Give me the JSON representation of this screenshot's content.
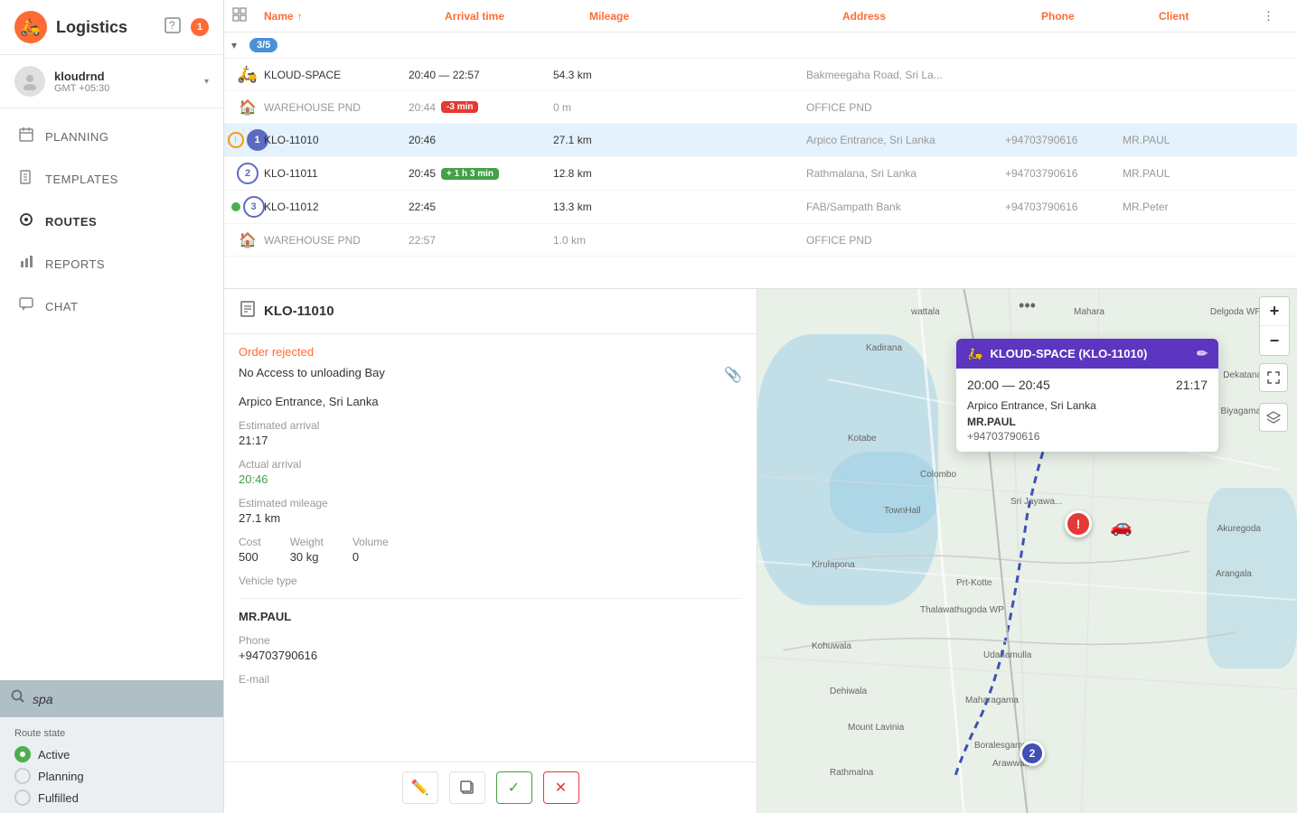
{
  "app": {
    "title": "Logistics",
    "badge": "1",
    "help_icon": "❓",
    "logo": "🛵"
  },
  "user": {
    "name": "kloudrnd",
    "timezone": "GMT +05:30"
  },
  "nav": {
    "items": [
      {
        "id": "planning",
        "label": "PLANNING",
        "icon": "📅"
      },
      {
        "id": "templates",
        "label": "TEMPLATES",
        "icon": "📄"
      },
      {
        "id": "routes",
        "label": "ROUTES",
        "icon": "👤",
        "active": true
      },
      {
        "id": "reports",
        "label": "REPORTS",
        "icon": "📊"
      },
      {
        "id": "chat",
        "label": "CHAT",
        "icon": "💬"
      }
    ]
  },
  "search": {
    "placeholder": "spa",
    "value": "spa"
  },
  "route_state": {
    "label": "Route state",
    "options": [
      {
        "id": "active",
        "label": "Active",
        "selected": true
      },
      {
        "id": "planning",
        "label": "Planning",
        "selected": false
      },
      {
        "id": "fulfilled",
        "label": "Fulfilled",
        "selected": false
      }
    ]
  },
  "table": {
    "columns": {
      "name": "Name",
      "arrival_time": "Arrival time",
      "mileage": "Mileage",
      "address": "Address",
      "phone": "Phone",
      "client": "Client"
    },
    "route": {
      "badge": "3/5",
      "stops": [
        {
          "id": "kloud-space",
          "icon_type": "scooter",
          "name": "KLOUD-SPACE",
          "arrival": "20:40 — 22:57",
          "mileage": "54.3 km",
          "address": "Bakmeegaha Road, Sri La...",
          "phone": "",
          "client": ""
        },
        {
          "id": "warehouse-pnd-1",
          "icon_type": "warehouse",
          "name": "WAREHOUSE PND",
          "arrival": "20:44",
          "time_badge": "-3 min",
          "time_badge_type": "red",
          "mileage": "0 m",
          "address": "OFFICE PND",
          "phone": "",
          "client": ""
        },
        {
          "id": "klo-11010",
          "icon_type": "number",
          "number": "1",
          "name": "KLO-11010",
          "arrival": "20:46",
          "mileage": "27.1 km",
          "address": "Arpico Entrance, Sri Lanka",
          "phone": "+94703790616",
          "client": "MR.PAUL",
          "highlighted": true
        },
        {
          "id": "klo-11011",
          "icon_type": "number",
          "number": "2",
          "name": "KLO-11011",
          "arrival": "20:45",
          "time_badge": "+ 1 h 3 min",
          "time_badge_type": "green",
          "mileage": "12.8 km",
          "address": "Rathmalana, Sri Lanka",
          "phone": "+94703790616",
          "client": "MR.PAUL"
        },
        {
          "id": "klo-11012",
          "icon_type": "number_open",
          "number": "3",
          "name": "KLO-11012",
          "arrival": "22:45",
          "mileage": "13.3 km",
          "address": "FAB/Sampath Bank",
          "phone": "+94703790616",
          "client": "MR.Peter",
          "has_dot": true
        },
        {
          "id": "warehouse-pnd-2",
          "icon_type": "warehouse",
          "name": "WAREHOUSE PND",
          "arrival": "22:57",
          "mileage": "1.0 km",
          "address": "OFFICE PND",
          "phone": "",
          "client": ""
        }
      ]
    }
  },
  "detail": {
    "order_id": "KLO-11010",
    "status": "Order rejected",
    "note": "No Access to unloading Bay",
    "address": "Arpico Entrance, Sri Lanka",
    "estimated_arrival_label": "Estimated arrival",
    "estimated_arrival": "21:17",
    "actual_arrival_label": "Actual arrival",
    "actual_arrival": "20:46",
    "estimated_mileage_label": "Estimated mileage",
    "estimated_mileage": "27.1 km",
    "cost_label": "Cost",
    "cost": "500",
    "weight_label": "Weight",
    "weight": "30 kg",
    "volume_label": "Volume",
    "volume": "0",
    "vehicle_type_label": "Vehicle type",
    "vehicle_type": "",
    "contact_name": "MR.PAUL",
    "phone_label": "Phone",
    "phone": "+94703790616",
    "email_label": "E-mail",
    "email": ""
  },
  "map_popup": {
    "title": "KLOUD-SPACE (KLO-11010)",
    "time_range": "20:00 — 20:45",
    "actual_time": "21:17",
    "address": "Arpico Entrance, Sri Lanka",
    "name": "MR.PAUL",
    "phone": "+94703790616"
  },
  "footer_buttons": {
    "edit": "✏️",
    "copy": "⧉",
    "confirm": "✓",
    "cancel": "✕"
  }
}
